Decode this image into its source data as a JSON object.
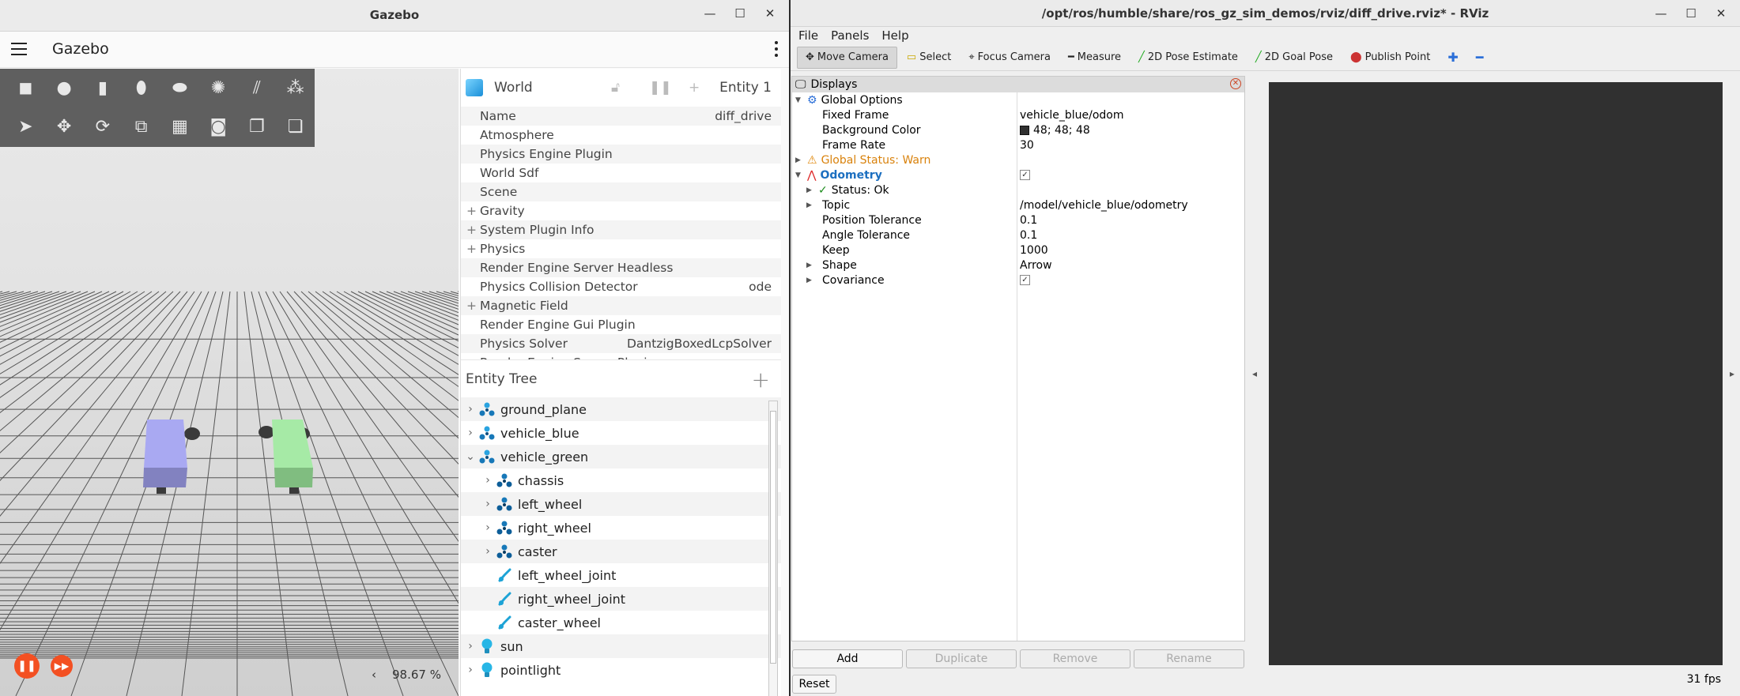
{
  "gazebo": {
    "window_title": "Gazebo",
    "app_title": "Gazebo",
    "real_time_factor": "98.67 %",
    "component_inspector": {
      "title": "World",
      "entity": "Entity 1",
      "properties": [
        {
          "label": "Name",
          "value": "diff_drive",
          "expandable": false
        },
        {
          "label": "Atmosphere",
          "value": "",
          "expandable": false
        },
        {
          "label": "Physics Engine Plugin",
          "value": "",
          "expandable": false
        },
        {
          "label": "World Sdf",
          "value": "",
          "expandable": false
        },
        {
          "label": "Scene",
          "value": "",
          "expandable": false
        },
        {
          "label": "Gravity",
          "value": "",
          "expandable": true
        },
        {
          "label": "System Plugin Info",
          "value": "",
          "expandable": true
        },
        {
          "label": "Physics",
          "value": "",
          "expandable": true
        },
        {
          "label": "Render Engine Server Headless",
          "value": "",
          "expandable": false
        },
        {
          "label": "Physics Collision Detector",
          "value": "ode",
          "expandable": false
        },
        {
          "label": "Magnetic Field",
          "value": "",
          "expandable": true
        },
        {
          "label": "Render Engine Gui Plugin",
          "value": "",
          "expandable": false
        },
        {
          "label": "Physics Solver",
          "value": "DantzigBoxedLcpSolver",
          "expandable": false
        },
        {
          "label": "Render Engine Server Plugin",
          "value": "",
          "expandable": false
        }
      ]
    },
    "entity_tree": {
      "title": "Entity Tree",
      "items": [
        {
          "label": "ground_plane",
          "indent": 0,
          "chevron": "right",
          "icon": "model-icon"
        },
        {
          "label": "vehicle_blue",
          "indent": 0,
          "chevron": "right",
          "icon": "model-icon"
        },
        {
          "label": "vehicle_green",
          "indent": 0,
          "chevron": "down",
          "icon": "model-icon"
        },
        {
          "label": "chassis",
          "indent": 1,
          "chevron": "right",
          "icon": "link-icon"
        },
        {
          "label": "left_wheel",
          "indent": 1,
          "chevron": "right",
          "icon": "link-icon"
        },
        {
          "label": "right_wheel",
          "indent": 1,
          "chevron": "right",
          "icon": "link-icon"
        },
        {
          "label": "caster",
          "indent": 1,
          "chevron": "right",
          "icon": "link-icon"
        },
        {
          "label": "left_wheel_joint",
          "indent": 1,
          "chevron": "",
          "icon": "joint-icon"
        },
        {
          "label": "right_wheel_joint",
          "indent": 1,
          "chevron": "",
          "icon": "joint-icon"
        },
        {
          "label": "caster_wheel",
          "indent": 1,
          "chevron": "",
          "icon": "joint-icon"
        },
        {
          "label": "sun",
          "indent": 0,
          "chevron": "right",
          "icon": "light-icon"
        },
        {
          "label": "pointlight",
          "indent": 0,
          "chevron": "right",
          "icon": "light-icon"
        }
      ]
    }
  },
  "rviz": {
    "window_title": "/opt/ros/humble/share/ros_gz_sim_demos/rviz/diff_drive.rviz* - RViz",
    "menus": [
      "File",
      "Panels",
      "Help"
    ],
    "tools": [
      "Move Camera",
      "Select",
      "Focus Camera",
      "Measure",
      "2D Pose Estimate",
      "2D Goal Pose",
      "Publish Point"
    ],
    "active_tool": "Move Camera",
    "displays_title": "Displays",
    "rows": [
      {
        "indent": 0,
        "arrow": "down",
        "label": "Global Options",
        "value": "",
        "kind": "global"
      },
      {
        "indent": 1,
        "arrow": "",
        "label": "Fixed Frame",
        "value": "vehicle_blue/odom",
        "kind": "plain"
      },
      {
        "indent": 1,
        "arrow": "",
        "label": "Background Color",
        "value": "48; 48; 48",
        "kind": "color"
      },
      {
        "indent": 1,
        "arrow": "",
        "label": "Frame Rate",
        "value": "30",
        "kind": "plain"
      },
      {
        "indent": 0,
        "arrow": "right",
        "label": "Global Status: Warn",
        "value": "",
        "kind": "warn"
      },
      {
        "indent": 0,
        "arrow": "down",
        "label": "Odometry",
        "value": "",
        "kind": "odometry"
      },
      {
        "indent": 1,
        "arrow": "right",
        "label": "Status: Ok",
        "value": "",
        "kind": "ok"
      },
      {
        "indent": 1,
        "arrow": "right",
        "label": "Topic",
        "value": "/model/vehicle_blue/odometry",
        "kind": "plain"
      },
      {
        "indent": 1,
        "arrow": "",
        "label": "Position Tolerance",
        "value": "0.1",
        "kind": "plain"
      },
      {
        "indent": 1,
        "arrow": "",
        "label": "Angle Tolerance",
        "value": "0.1",
        "kind": "plain"
      },
      {
        "indent": 1,
        "arrow": "",
        "label": "Keep",
        "value": "1000",
        "kind": "plain"
      },
      {
        "indent": 1,
        "arrow": "right",
        "label": "Shape",
        "value": "Arrow",
        "kind": "plain"
      },
      {
        "indent": 1,
        "arrow": "right",
        "label": "Covariance",
        "value": "",
        "kind": "check"
      }
    ],
    "buttons": {
      "add": "Add",
      "duplicate": "Duplicate",
      "remove": "Remove",
      "rename": "Rename",
      "reset": "Reset"
    },
    "fps": "31 fps",
    "colors": {
      "background": "#303030",
      "warn": "#d9820c",
      "accent": "#1c6fc0"
    }
  }
}
